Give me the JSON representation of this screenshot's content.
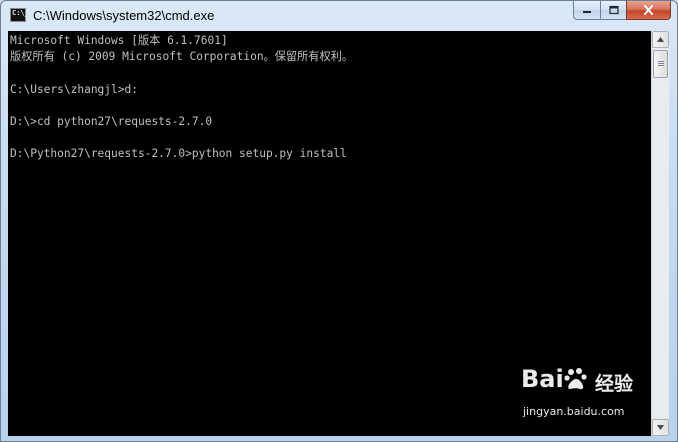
{
  "window": {
    "title": "C:\\Windows\\system32\\cmd.exe",
    "icon": "cmd-icon",
    "icon_text": "C:\\_"
  },
  "controls": {
    "minimize": "minimize-icon",
    "maximize": "maximize-icon",
    "close": "close-icon"
  },
  "console": {
    "lines": [
      "Microsoft Windows [版本 6.1.7601]",
      "版权所有 (c) 2009 Microsoft Corporation。保留所有权利。",
      "",
      "C:\\Users\\zhangjl>d:",
      "",
      "D:\\>cd python27\\requests-2.7.0",
      "",
      "D:\\Python27\\requests-2.7.0>python setup.py install"
    ],
    "text_color": "#c0c0c0",
    "background": "#000000"
  },
  "watermark": {
    "brand": "Bai",
    "brand_suffix": "du",
    "cn": "经验",
    "url": "jingyan.baidu.com"
  }
}
